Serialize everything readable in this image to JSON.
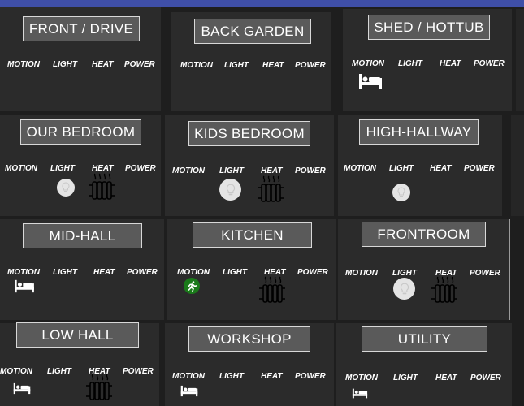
{
  "labels": {
    "motion": "MOTION",
    "light": "LIGHT",
    "heat": "HEAT",
    "power": "POWER"
  },
  "rooms": [
    {
      "name": "FRONT / DRIVE",
      "motion_icon": "",
      "light_on": false,
      "heat_on": false
    },
    {
      "name": "BACK GARDEN",
      "motion_icon": "",
      "light_on": false,
      "heat_on": false
    },
    {
      "name": "SHED / HOTTUB",
      "motion_icon": "bed-icon",
      "light_on": false,
      "heat_on": false
    },
    {
      "name": "OUR BEDROOM",
      "motion_icon": "",
      "light_on": true,
      "heat_on": true
    },
    {
      "name": "KIDS BEDROOM",
      "motion_icon": "",
      "light_on": true,
      "heat_on": true
    },
    {
      "name": "HIGH-HALLWAY",
      "motion_icon": "",
      "light_on": true,
      "heat_on": false
    },
    {
      "name": "MID-HALL",
      "motion_icon": "bed-icon",
      "light_on": false,
      "heat_on": false
    },
    {
      "name": "KITCHEN",
      "motion_icon": "running-person-icon",
      "light_on": false,
      "heat_on": true
    },
    {
      "name": "FRONTROOM",
      "motion_icon": "",
      "light_on": true,
      "heat_on": true
    },
    {
      "name": "LOW HALL",
      "motion_icon": "bed-icon",
      "light_on": false,
      "heat_on": true
    },
    {
      "name": "WORKSHOP",
      "motion_icon": "bed-icon",
      "light_on": false,
      "heat_on": false
    },
    {
      "name": "UTILITY",
      "motion_icon": "bed-icon",
      "light_on": false,
      "heat_on": false
    }
  ],
  "colors": {
    "background": "#1e1e1e",
    "panel": "#2b2b2b",
    "title_box": "#5a5a5a",
    "accent_bar": "#3f4fa8",
    "motion_active": "#1a7a1a"
  }
}
